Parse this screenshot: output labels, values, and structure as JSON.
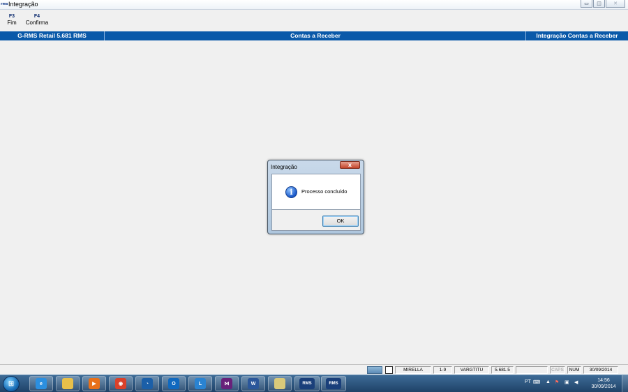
{
  "window": {
    "title": "Integração",
    "app_icon_text": "rms",
    "controls": {
      "minimize": "▭",
      "maximize": "◫",
      "close": "✕"
    }
  },
  "function_keys": [
    {
      "key": "F3",
      "label": "Fim"
    },
    {
      "key": "F4",
      "label": "Confirma"
    }
  ],
  "header": {
    "left": "G-RMS Retail 5.681 RMS",
    "center": "Contas a Receber",
    "right": "Integração Contas a Receber"
  },
  "dialog": {
    "title": "Integração",
    "close_glyph": "x",
    "icon": "info-icon",
    "message": "Processo concluído",
    "ok_label": "OK"
  },
  "statusbar": {
    "user": "MIRELLA",
    "branch": "1-9",
    "program": "VARGTITU",
    "version": "5.681.5",
    "empty": "",
    "caps": "CAPS",
    "num": "NUM",
    "date": "30/09/2014"
  },
  "taskbar": {
    "start_glyph": "⊞",
    "apps": [
      {
        "name": "internet-explorer-icon",
        "glyph": "e",
        "color": "#2b8fe0"
      },
      {
        "name": "file-explorer-icon",
        "glyph": "",
        "color": "#e8c04a"
      },
      {
        "name": "media-player-icon",
        "glyph": "▶",
        "color": "#e8701a"
      },
      {
        "name": "chrome-icon",
        "glyph": "◉",
        "color": "#d9412b"
      },
      {
        "name": "app-icon",
        "glyph": "◔",
        "color": "#1b5fa8"
      },
      {
        "name": "outlook-icon",
        "glyph": "O",
        "color": "#1069bf"
      },
      {
        "name": "lync-icon",
        "glyph": "L",
        "color": "#2a83d1"
      },
      {
        "name": "visual-studio-icon",
        "glyph": "⋈",
        "color": "#68217a"
      },
      {
        "name": "word-icon",
        "glyph": "W",
        "color": "#2b579a"
      },
      {
        "name": "folder-icon",
        "glyph": "",
        "color": "#d8c97a"
      },
      {
        "name": "rms-app-icon",
        "glyph": "RMS",
        "color": "#1a3f7a"
      },
      {
        "name": "rms-app-icon",
        "glyph": "RMS",
        "color": "#1a3f7a"
      }
    ],
    "language": "PT",
    "time": "14:56",
    "date": "30/09/2014"
  }
}
